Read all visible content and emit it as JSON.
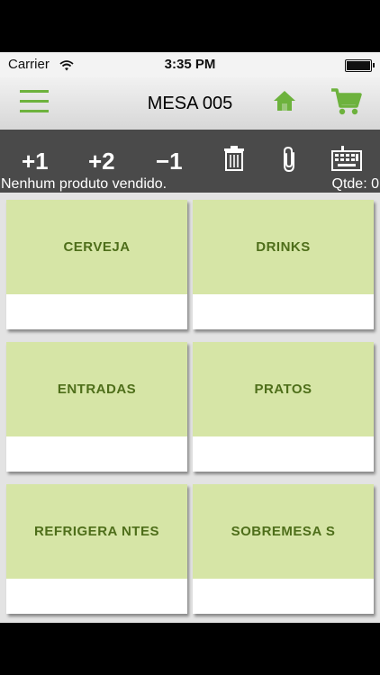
{
  "status_bar": {
    "carrier": "Carrier",
    "time": "3:35 PM"
  },
  "nav": {
    "title": "MESA 005",
    "accent": "#6db23d"
  },
  "toolbar": {
    "plus_one": "+1",
    "plus_two": "+2",
    "minus_one": "−1",
    "status": "Nenhum produto vendido.",
    "qty": "Qtde: 0"
  },
  "categories": [
    "CERVEJA",
    "DRINKS",
    "ENTRADAS",
    "PRATOS",
    "REFRIGERA NTES",
    "SOBREMESA S"
  ],
  "colors": {
    "tile_green": "#d6e5a6",
    "tile_text": "#4e6e1a",
    "toolbar_bg": "#4a4a4a"
  }
}
